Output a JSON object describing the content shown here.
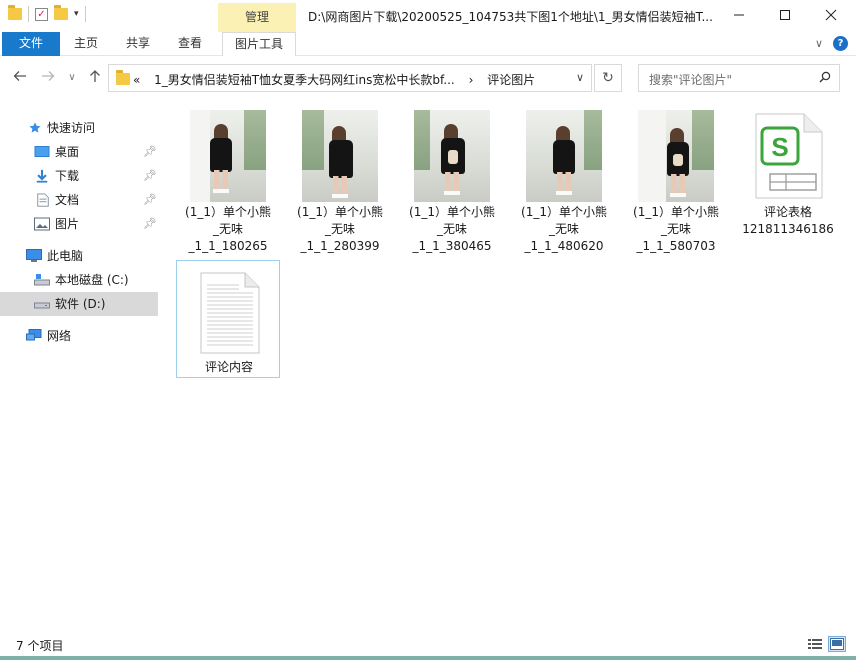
{
  "window": {
    "manage_tab": "管理",
    "title": "D:\\网商图片下载\\20200525_104753共下图1个地址\\1_男女情侣装短袖T..."
  },
  "ribbon": {
    "tabs": [
      {
        "label": "文件"
      },
      {
        "label": "主页"
      },
      {
        "label": "共享"
      },
      {
        "label": "查看"
      },
      {
        "label": "图片工具"
      }
    ]
  },
  "address": {
    "overflow": "«",
    "segments": [
      "1_男女情侣装短袖T恤女夏季大码网红ins宽松中长款bf...",
      "评论图片"
    ],
    "separator": "›"
  },
  "search": {
    "placeholder": "搜索\"评论图片\""
  },
  "sidebar": {
    "quick_access": "快速访问",
    "items": [
      {
        "label": "桌面",
        "pinned": true
      },
      {
        "label": "下载",
        "pinned": true
      },
      {
        "label": "文档",
        "pinned": true
      },
      {
        "label": "图片",
        "pinned": true
      }
    ],
    "this_pc": "此电脑",
    "drives": [
      {
        "label": "本地磁盘 (C:)"
      },
      {
        "label": "软件 (D:)",
        "selected": true
      }
    ],
    "network": "网络"
  },
  "files": [
    {
      "type": "image",
      "lines": [
        "(1_1）单个小熊",
        "_无味",
        "_1_1_180265"
      ]
    },
    {
      "type": "image",
      "lines": [
        "(1_1）单个小熊",
        "_无味",
        "_1_1_280399"
      ]
    },
    {
      "type": "image",
      "lines": [
        "(1_1）单个小熊",
        "_无味",
        "_1_1_380465"
      ]
    },
    {
      "type": "image",
      "lines": [
        "(1_1）单个小熊",
        "_无味",
        "_1_1_480620"
      ]
    },
    {
      "type": "image",
      "lines": [
        "(1_1）单个小熊",
        "_无味",
        "_1_1_580703"
      ]
    },
    {
      "type": "spreadsheet",
      "lines": [
        "评论表格",
        "121811346186"
      ]
    },
    {
      "type": "text",
      "lines": [
        "评论内容"
      ],
      "selected": true
    }
  ],
  "status": {
    "count": "7 个项目"
  },
  "colors": {
    "accent": "#1979ca",
    "manage_tab": "#fbf1b5",
    "spreadsheet_green": "#3aa53a",
    "selection": "#9fd0ee"
  }
}
